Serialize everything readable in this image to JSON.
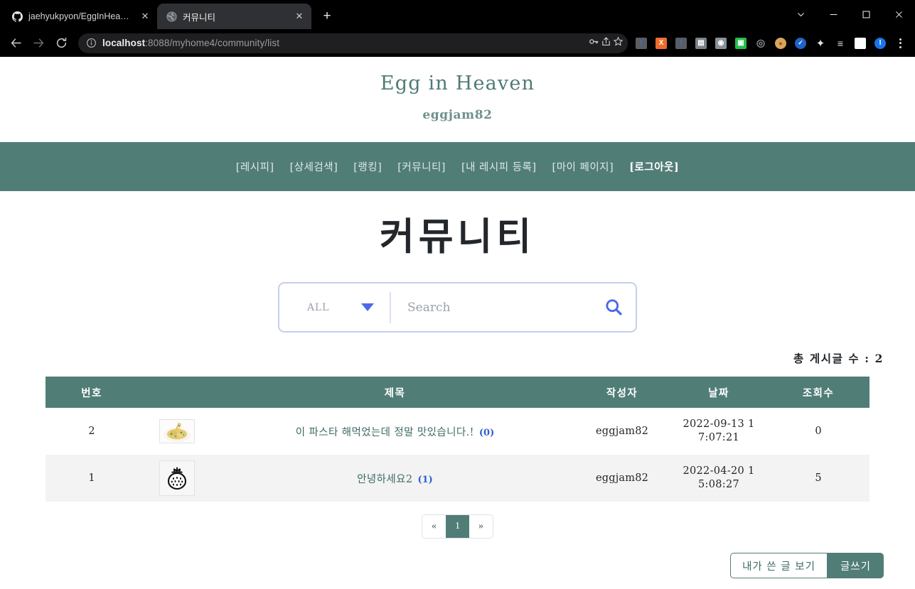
{
  "browser": {
    "tabs": [
      {
        "title": "jaehyukpyon/EggInHeaven",
        "favicon": "github-icon",
        "active": false
      },
      {
        "title": "커뮤니티",
        "favicon": "globe-icon",
        "active": true
      }
    ],
    "new_tab_label": "+",
    "window_controls": [
      "chevron-down-icon",
      "minimize-icon",
      "maximize-icon",
      "close-icon"
    ],
    "nav": {
      "back": "←",
      "forward": "→",
      "reload": "⟳"
    },
    "address": {
      "host": "localhost",
      "path": ":8088/myhome4/community/list",
      "full": "localhost:8088/myhome4/community/list"
    },
    "omni_actions": [
      "key-icon",
      "share-icon",
      "bookmark-star-icon"
    ],
    "extensions": [
      {
        "name": "ext-blue-bar-1",
        "glyph": "I",
        "bg": "#5a5d62",
        "fg": "#3b6fe0"
      },
      {
        "name": "ext-orange",
        "glyph": "X",
        "bg": "#ef6c2b",
        "fg": "#ffffff"
      },
      {
        "name": "ext-blue-bar-2",
        "glyph": "I",
        "bg": "#5a5d62",
        "fg": "#3b6fe0"
      },
      {
        "name": "ext-window",
        "glyph": "▤",
        "bg": "#7b8089",
        "fg": "#ffffff"
      },
      {
        "name": "ext-camera",
        "glyph": "◉",
        "bg": "#8b9099",
        "fg": "#ffffff"
      },
      {
        "name": "ext-tv",
        "glyph": "▣",
        "bg": "#21c04a",
        "fg": "#ffffff"
      },
      {
        "name": "ext-eye",
        "glyph": "◎",
        "bg": "#5a5d62",
        "fg": "#9a9ea5"
      },
      {
        "name": "ext-cookie",
        "glyph": "●",
        "bg": "#d9a45c",
        "fg": "#8a5a22"
      },
      {
        "name": "ext-check",
        "glyph": "✓",
        "bg": "#1f63c8",
        "fg": "#ffffff"
      },
      {
        "name": "ext-puzzle",
        "glyph": "✦",
        "bg": "transparent",
        "fg": "#e3e3e5"
      },
      {
        "name": "ext-playlist",
        "glyph": "≡",
        "bg": "transparent",
        "fg": "#e3e3e5"
      },
      {
        "name": "ext-sidepanel",
        "glyph": "▯",
        "bg": "transparent",
        "fg": "#e3e3e5"
      },
      {
        "name": "ext-profile",
        "glyph": "I",
        "bg": "#1a73e8",
        "fg": "#ffffff"
      }
    ],
    "menu_label": "⋮"
  },
  "site": {
    "title": "Egg in Heaven",
    "username": "eggjam82",
    "nav_items": [
      {
        "label": "[레시피]",
        "strong": false
      },
      {
        "label": "[상세검색]",
        "strong": false
      },
      {
        "label": "[랭킹]",
        "strong": false
      },
      {
        "label": "[커뮤니티]",
        "strong": false
      },
      {
        "label": "[내 레시피 등록]",
        "strong": false
      },
      {
        "label": "[마이 페이지]",
        "strong": false
      },
      {
        "label": "[로그아웃]",
        "strong": true
      }
    ]
  },
  "main": {
    "page_title": "커뮤니티",
    "search": {
      "select_value": "ALL",
      "select_options": [
        "ALL"
      ],
      "placeholder": "Search",
      "value": "",
      "search_icon": "magnifier-icon",
      "caret_icon": "caret-down-icon"
    },
    "total_label": "총 게시글 수 : 2",
    "table": {
      "headers": [
        "번호",
        "",
        "제목",
        "작성자",
        "날짜",
        "조회수"
      ],
      "rows": [
        {
          "no": "2",
          "thumb": "pasta-photo",
          "title": "이 파스타 해먹었는데 정말 맛있습니다.!",
          "comments": "(0)",
          "author": "eggjam82",
          "date_line1": "2022-09-13 1",
          "date_line2": "7:07:21",
          "hits": "0"
        },
        {
          "no": "1",
          "thumb": "strawberry-icon",
          "title": "안녕하세요2",
          "comments": "(1)",
          "author": "eggjam82",
          "date_line1": "2022-04-20 1",
          "date_line2": "5:08:27",
          "hits": "5"
        }
      ]
    },
    "pagination": {
      "prev": "«",
      "pages": [
        "1"
      ],
      "next": "»",
      "active": "1"
    },
    "buttons": {
      "my_posts": "내가 쓴 글 보기",
      "write": "글쓰기"
    }
  },
  "colors": {
    "teal": "#517d77",
    "title_teal": "#4f7a75",
    "link_teal": "#3d6b66",
    "comment_blue": "#2f5fd0",
    "search_border": "#c6cdee",
    "caret_blue": "#4a6ae8"
  }
}
